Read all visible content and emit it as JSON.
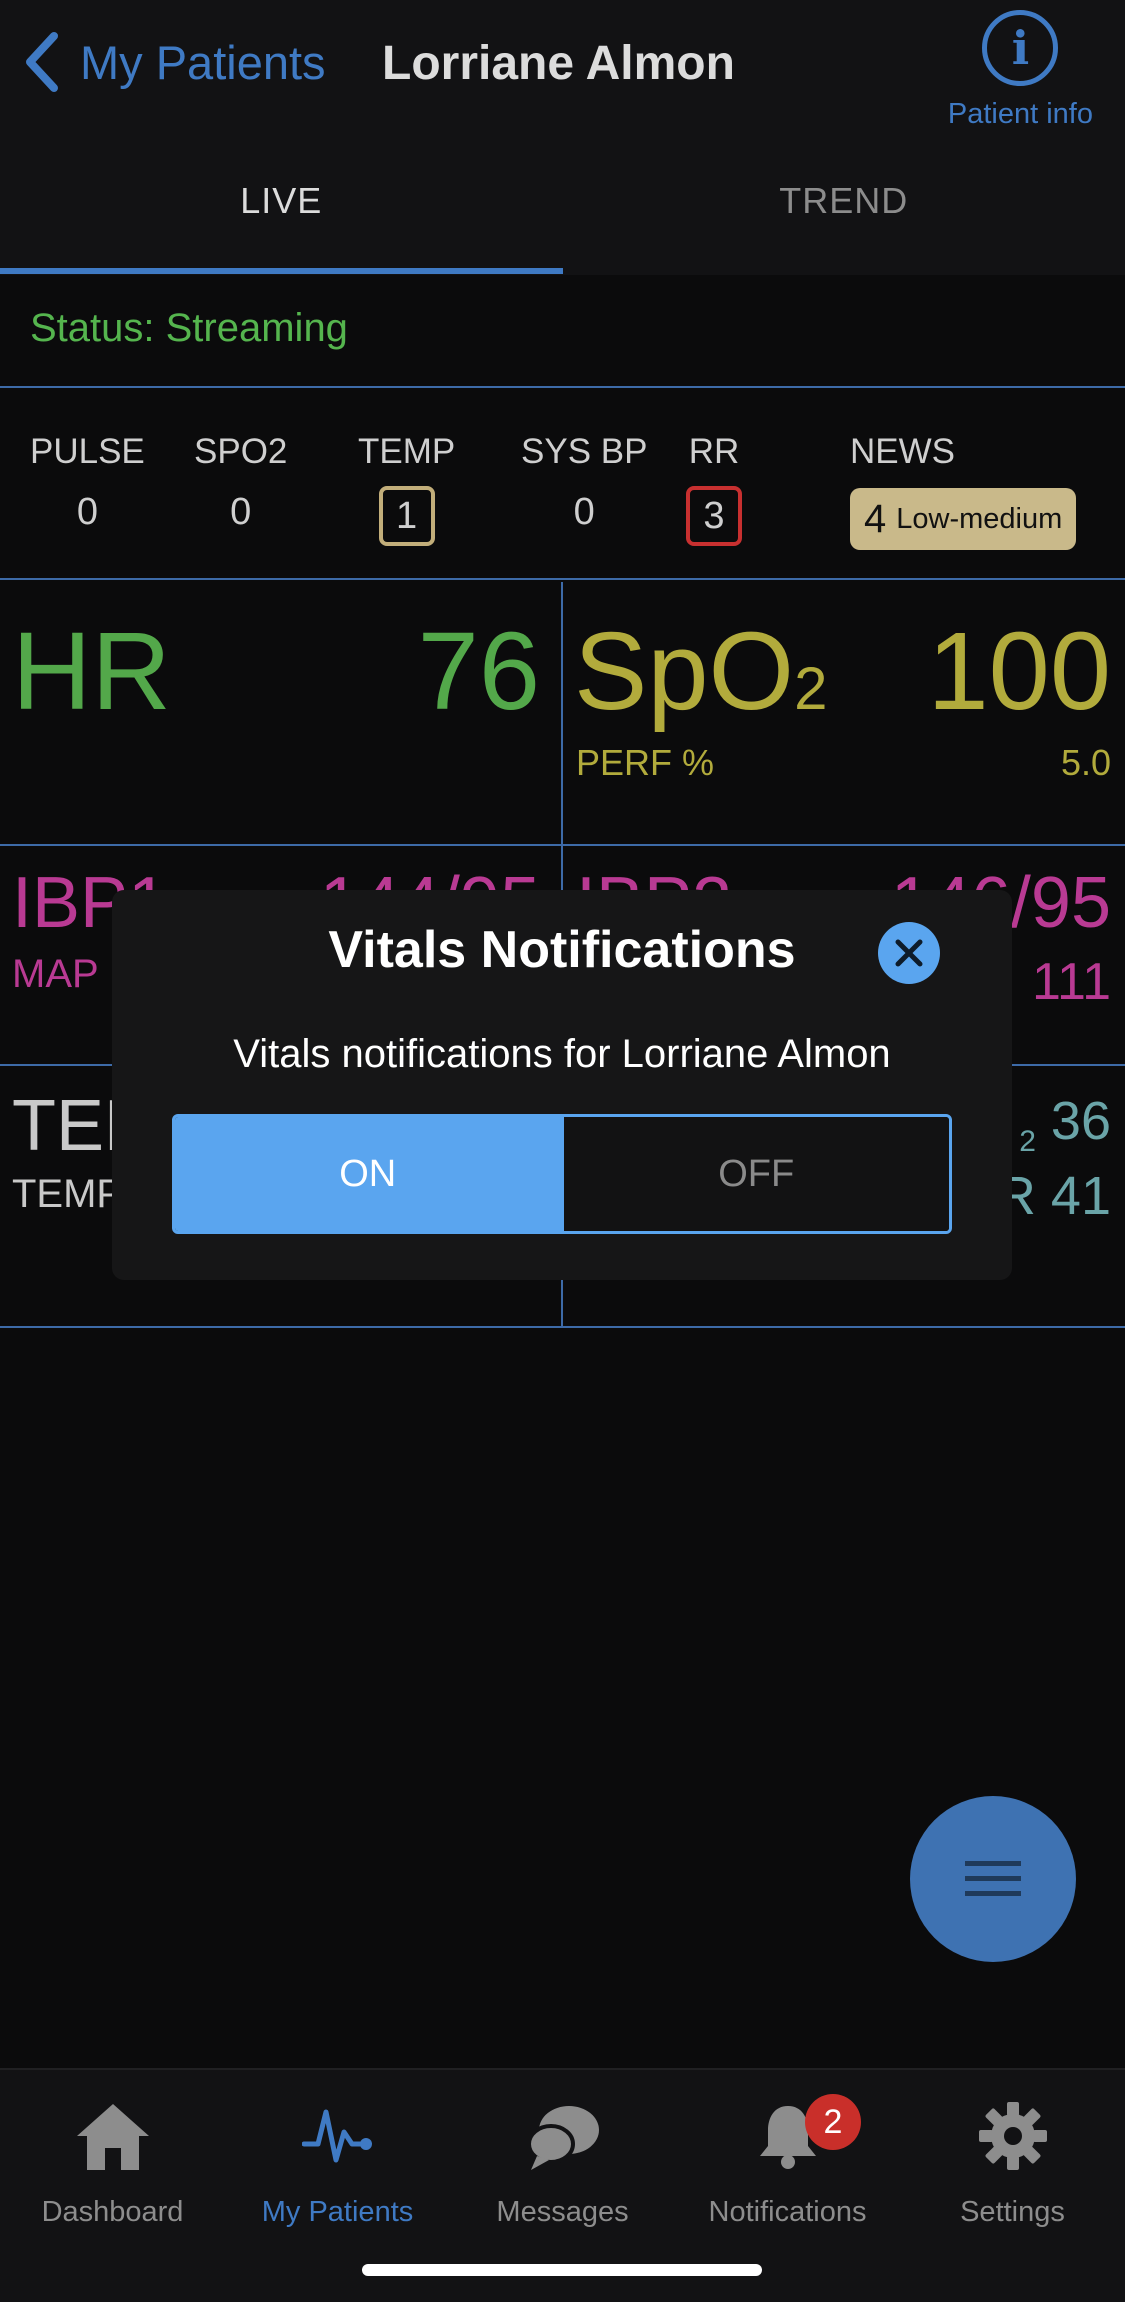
{
  "header": {
    "back_label": "My Patients",
    "title": "Lorriane Almon",
    "info_label": "Patient info"
  },
  "tabs": [
    {
      "label": "LIVE",
      "active": true
    },
    {
      "label": "TREND",
      "active": false
    }
  ],
  "status": "Status: Streaming",
  "scores": [
    {
      "label": "PULSE",
      "value": "0"
    },
    {
      "label": "SPO2",
      "value": "0"
    },
    {
      "label": "TEMP",
      "value": "1"
    },
    {
      "label": "SYS BP",
      "value": "0"
    },
    {
      "label": "RR",
      "value": "3"
    }
  ],
  "news": {
    "label": "NEWS",
    "score": "4",
    "level": "Low-medium"
  },
  "vitals": {
    "hr_label": "HR",
    "hr_value": "76",
    "spo2_label": "SpO",
    "spo2_sub": "2",
    "spo2_value": "100",
    "perf_label": "PERF %",
    "perf_value": "5.0",
    "ibp1_label": "IBP1",
    "ibp1_value": "144/95",
    "map_label": "MAP",
    "ibp2_label": "IBP2",
    "ibp2_value": "146/95",
    "map2_value": "111",
    "temp_label": "TEM",
    "temp_sub": "TEMP",
    "co2_sub": "2",
    "co2_value": "36",
    "rr_label": "R 41"
  },
  "modal": {
    "title": "Vitals Notifications",
    "text": "Vitals notifications for Lorriane Almon",
    "on_label": "ON",
    "off_label": "OFF"
  },
  "nav": [
    {
      "label": "Dashboard",
      "icon": "home-icon"
    },
    {
      "label": "My Patients",
      "icon": "heartbeat-icon",
      "active": true
    },
    {
      "label": "Messages",
      "icon": "chat-icon"
    },
    {
      "label": "Notifications",
      "icon": "bell-icon",
      "badge": "2"
    },
    {
      "label": "Settings",
      "icon": "gear-icon"
    }
  ],
  "colors": {
    "accent": "#3f7ac4",
    "modal_accent": "#5aa5ef",
    "hr": "#53a84a",
    "spo2": "#b2ab3c",
    "ibp": "#b93a93",
    "co2": "#6aa4a8",
    "news_badge": "#c9b98a",
    "alert": "#c92f2a"
  }
}
